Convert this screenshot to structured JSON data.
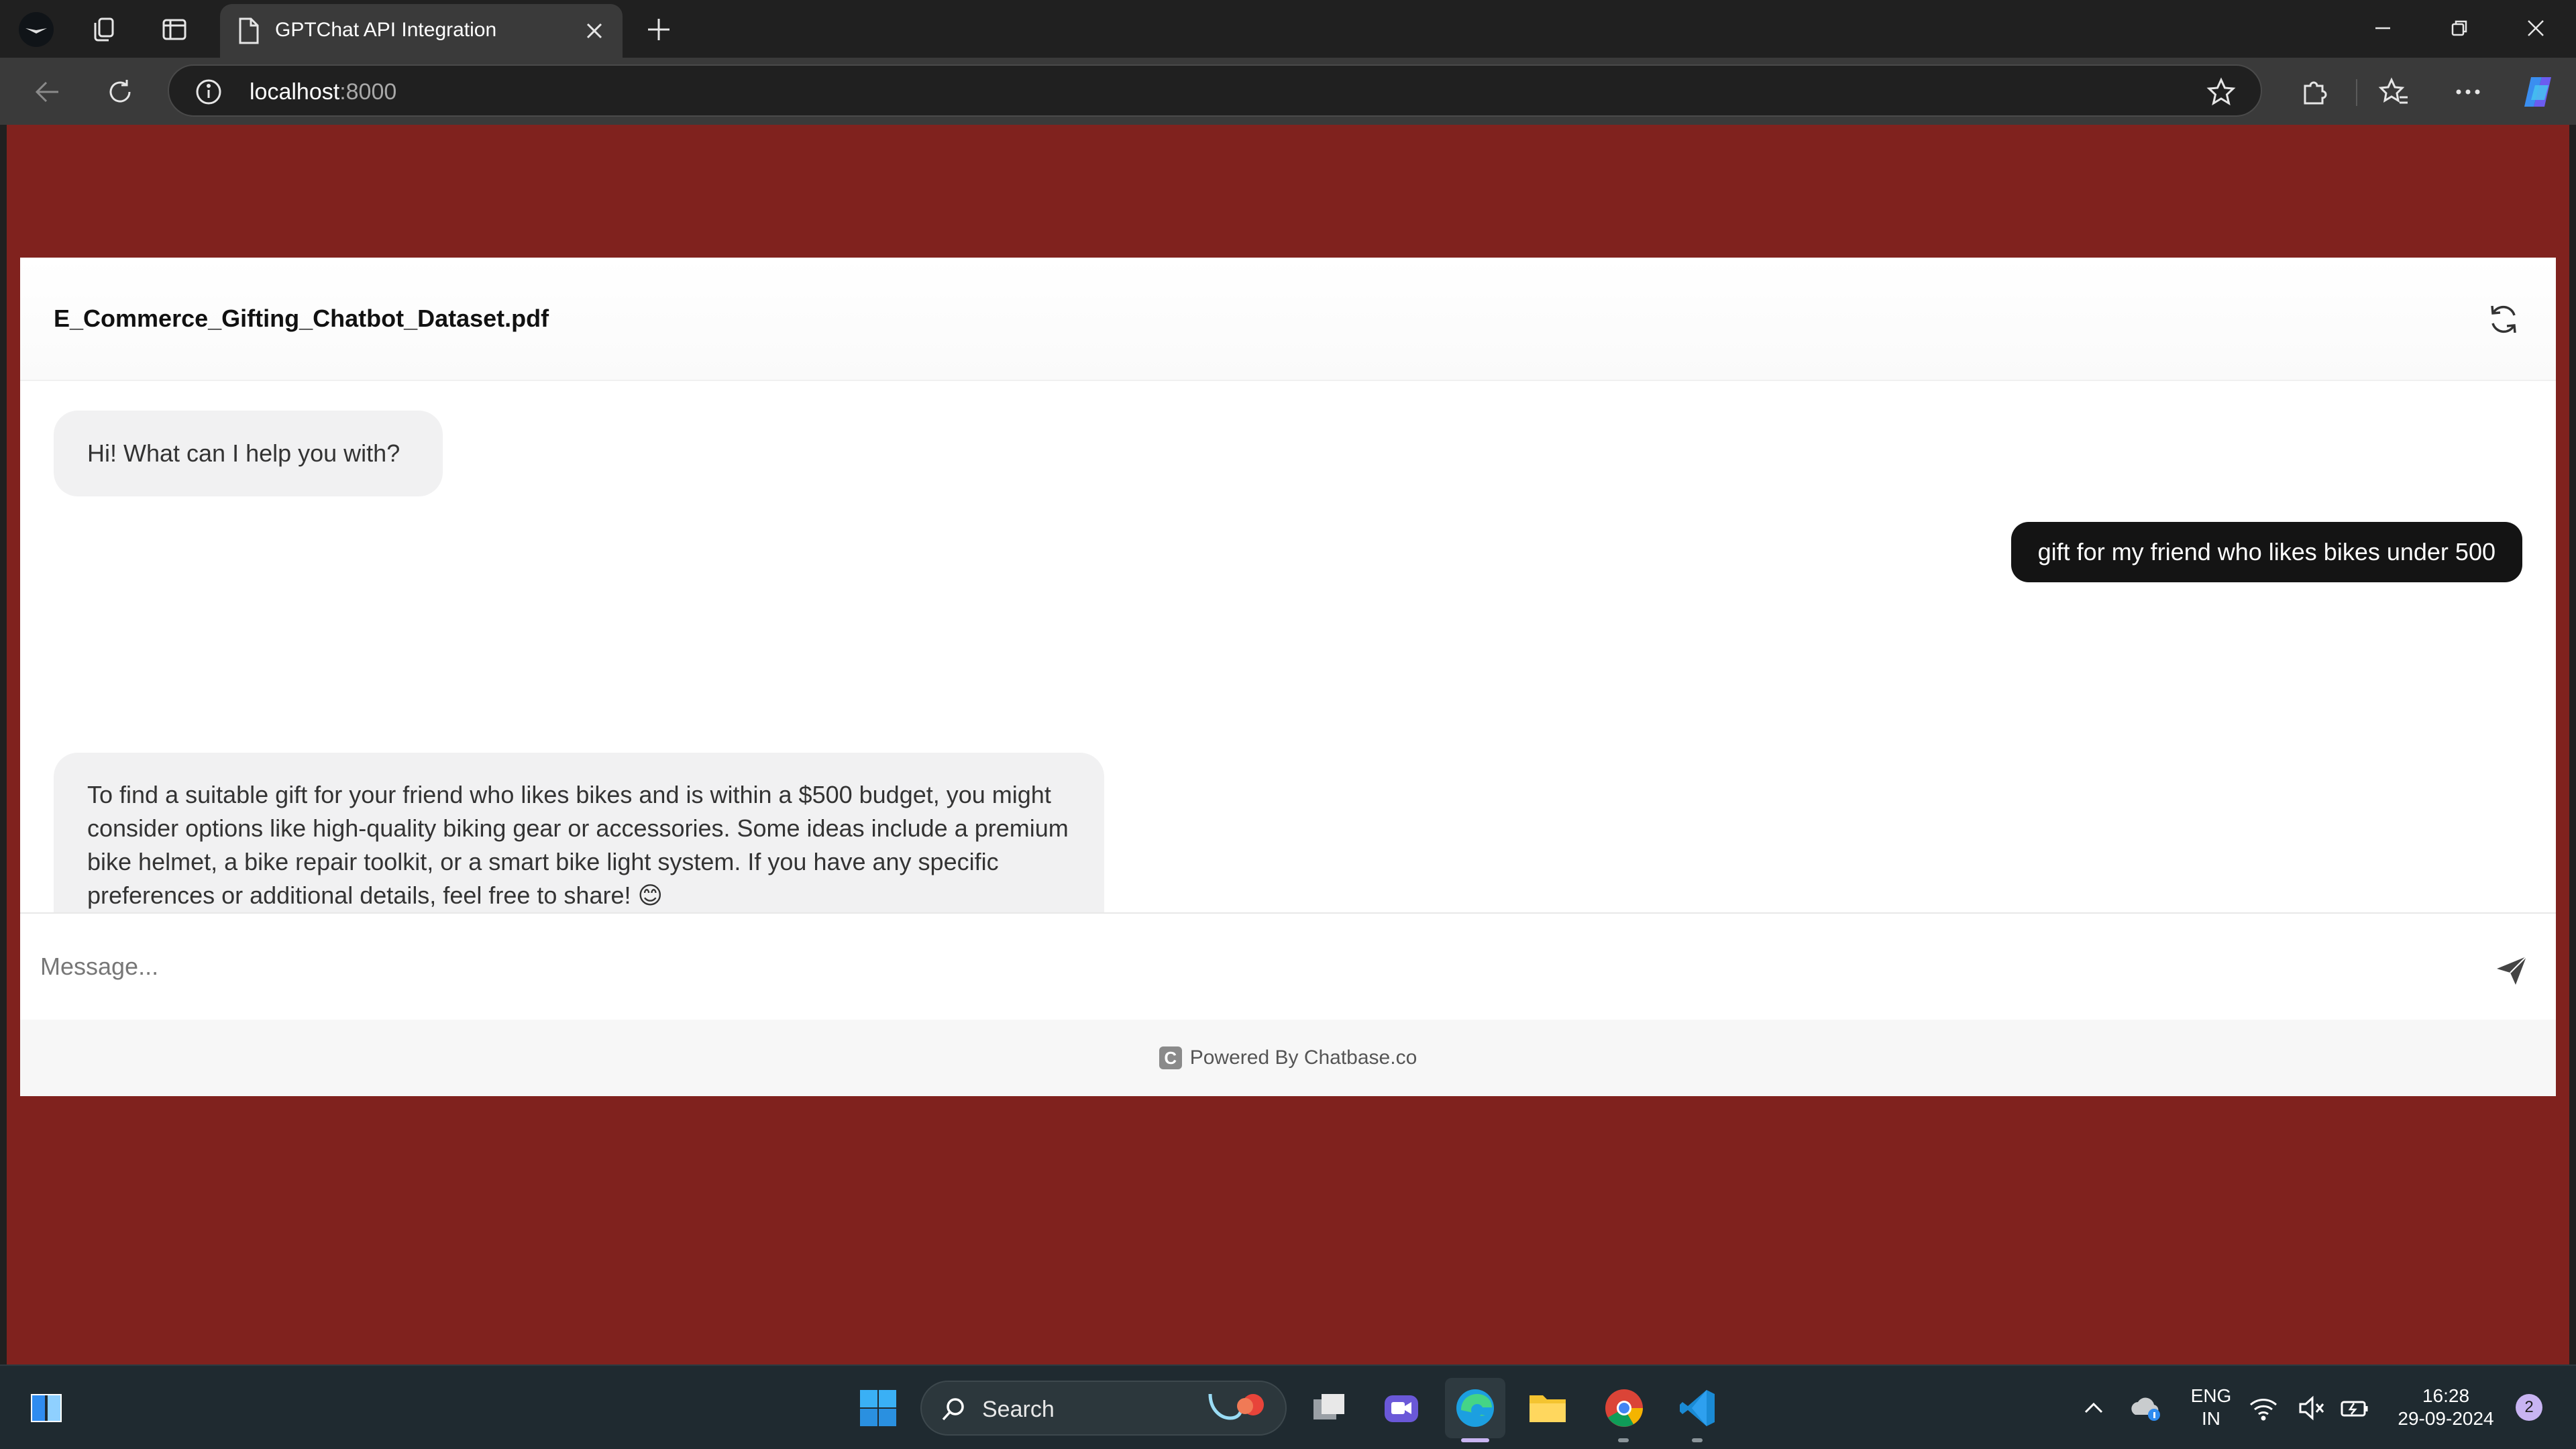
{
  "browser": {
    "tab_title": "GPTChat API Integration",
    "url_host": "localhost",
    "url_port": ":8000"
  },
  "chat": {
    "title": "E_Commerce_Gifting_Chatbot_Dataset.pdf",
    "messages": [
      {
        "role": "bot",
        "text": "Hi! What can I help you with?"
      },
      {
        "role": "user",
        "text": "gift for my friend who likes bikes under 500"
      },
      {
        "role": "bot",
        "text": "To find a suitable gift for your friend who likes bikes and is within a $500 budget, you might consider options like high-quality biking gear or accessories. Some ideas in­clude a premium bike helmet, a bike repair toolkit, or a smart bike light system. If you have any specific preferences or additional details, feel free to share! 😊"
      }
    ],
    "composer_placeholder": "Message...",
    "footer_text": "Powered By Chatbase.co",
    "footer_logo_letter": "C"
  },
  "taskbar": {
    "search_label": "Search",
    "lang_top": "ENG",
    "lang_bottom": "IN",
    "time": "16:28",
    "date": "29-09-2024",
    "notification_count": "2"
  },
  "colors": {
    "page_background": "#80221e",
    "user_bubble": "#141414",
    "bot_bubble": "#f1f1f2",
    "taskbar": "#1f2a30"
  },
  "icons": [
    "profile-icon",
    "workspaces-icon",
    "vertical-tabs-icon",
    "page-icon",
    "close-icon",
    "new-tab-icon",
    "minimize-icon",
    "restore-icon",
    "window-close-icon",
    "back-icon",
    "reload-icon",
    "info-icon",
    "star-icon",
    "extensions-icon",
    "favorites-icon",
    "more-icon",
    "copilot-icon",
    "refresh-icon",
    "copy-icon",
    "thumbs-down-icon",
    "send-icon",
    "widgets-icon",
    "windows-start-icon",
    "search-icon",
    "task-view-icon",
    "meet-icon",
    "edge-icon",
    "file-explorer-icon",
    "chrome-icon",
    "vscode-icon",
    "chevron-up-icon",
    "onedrive-icon",
    "wifi-icon",
    "volume-muted-icon",
    "battery-icon"
  ]
}
